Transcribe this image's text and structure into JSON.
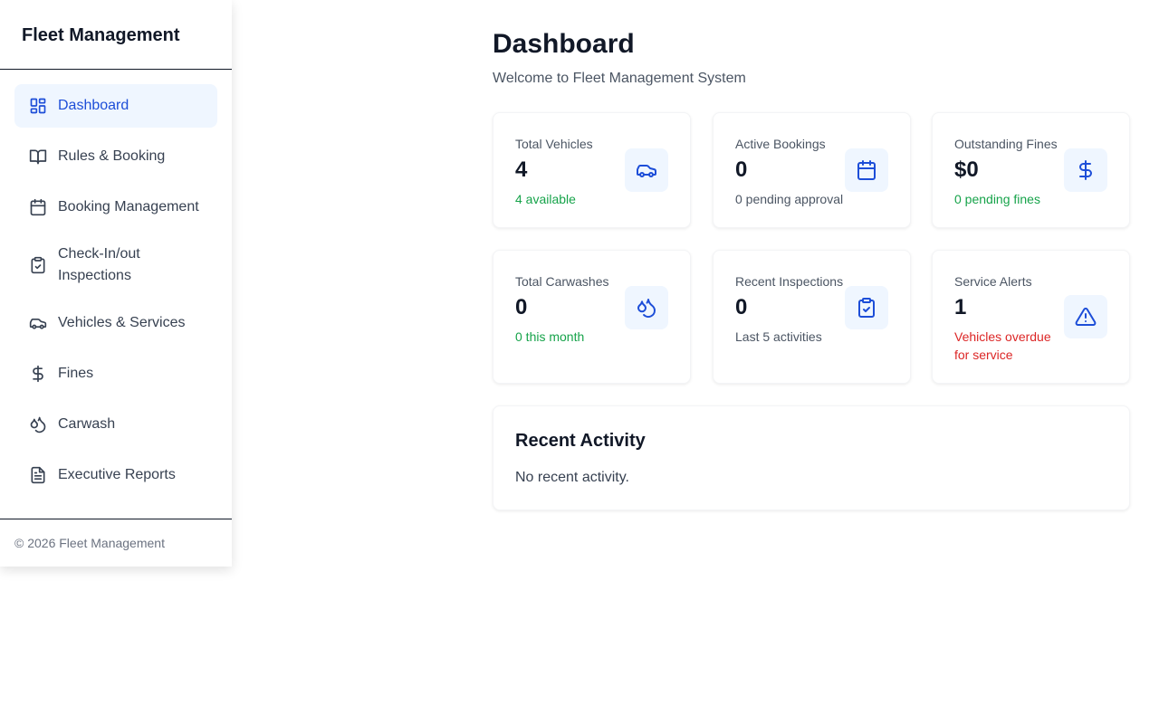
{
  "sidebar": {
    "title": "Fleet Management",
    "items": [
      {
        "label": "Dashboard",
        "icon": "dashboard-icon",
        "active": true
      },
      {
        "label": "Rules & Booking",
        "icon": "book-open-icon"
      },
      {
        "label": "Booking Management",
        "icon": "calendar-icon"
      },
      {
        "label": "Check-In/out Inspections",
        "icon": "clipboard-check-icon"
      },
      {
        "label": "Vehicles & Services",
        "icon": "car-icon"
      },
      {
        "label": "Fines",
        "icon": "dollar-icon"
      },
      {
        "label": "Carwash",
        "icon": "droplets-icon"
      },
      {
        "label": "Executive Reports",
        "icon": "file-text-icon"
      }
    ],
    "footer": "© 2026 Fleet Management"
  },
  "header": {
    "title": "Dashboard",
    "subtitle": "Welcome to Fleet Management System"
  },
  "stats": [
    {
      "label": "Total Vehicles",
      "value": "4",
      "sub": "4 available",
      "sub_color": "green",
      "icon": "car-icon"
    },
    {
      "label": "Active Bookings",
      "value": "0",
      "sub": "0 pending approval",
      "sub_color": "gray",
      "icon": "calendar-icon"
    },
    {
      "label": "Outstanding Fines",
      "value": "$0",
      "sub": "0 pending fines",
      "sub_color": "green",
      "icon": "dollar-icon"
    },
    {
      "label": "Total Carwashes",
      "value": "0",
      "sub": "0 this month",
      "sub_color": "green",
      "icon": "droplets-icon"
    },
    {
      "label": "Recent Inspections",
      "value": "0",
      "sub": "Last 5 activities",
      "sub_color": "gray",
      "icon": "clipboard-check-icon"
    },
    {
      "label": "Service Alerts",
      "value": "1",
      "sub": "Vehicles overdue for service",
      "sub_color": "red",
      "icon": "alert-triangle-icon"
    }
  ],
  "activity": {
    "title": "Recent Activity",
    "empty": "No recent activity."
  },
  "colors": {
    "accent": "#1d4ed8",
    "accent_bg": "#eff6ff",
    "green": "#16a34a",
    "red": "#dc2626"
  }
}
